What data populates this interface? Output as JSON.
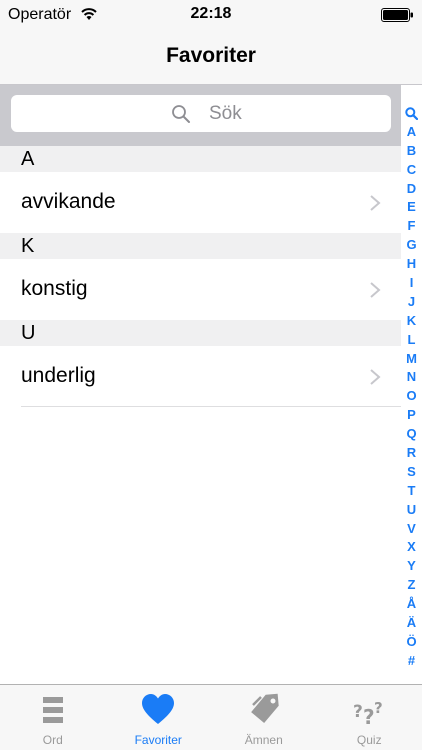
{
  "status": {
    "carrier": "Operatör",
    "time": "22:18"
  },
  "nav": {
    "title": "Favoriter"
  },
  "search": {
    "placeholder": "Sök"
  },
  "sections": [
    {
      "header": "A",
      "items": [
        "avvikande"
      ]
    },
    {
      "header": "K",
      "items": [
        "konstig"
      ]
    },
    {
      "header": "U",
      "items": [
        "underlig"
      ]
    }
  ],
  "index_letters": [
    "A",
    "B",
    "C",
    "D",
    "E",
    "F",
    "G",
    "H",
    "I",
    "J",
    "K",
    "L",
    "M",
    "N",
    "O",
    "P",
    "Q",
    "R",
    "S",
    "T",
    "U",
    "V",
    "X",
    "Y",
    "Z",
    "Å",
    "Ä",
    "Ö",
    "#"
  ],
  "tabs": [
    {
      "label": "Ord",
      "icon": "list-icon",
      "active": false
    },
    {
      "label": "Favoriter",
      "icon": "heart-icon",
      "active": true
    },
    {
      "label": "Ämnen",
      "icon": "tags-icon",
      "active": false
    },
    {
      "label": "Quiz",
      "icon": "question-marks-icon",
      "active": false
    }
  ],
  "colors": {
    "accent": "#1a7cf6",
    "inactive": "#9a9a9a",
    "section_bg": "#f0f0f1"
  }
}
